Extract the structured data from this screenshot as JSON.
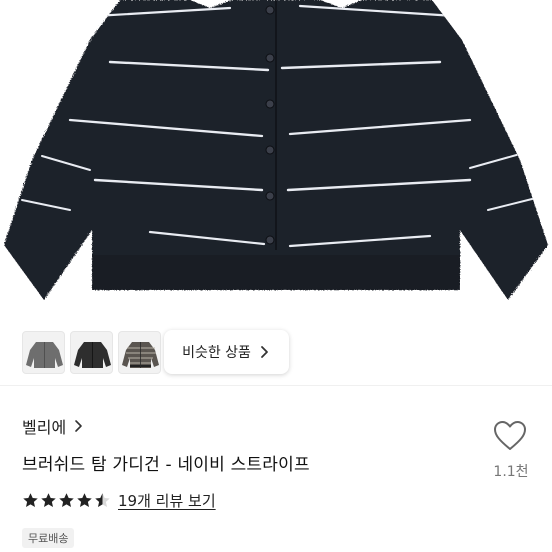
{
  "product": {
    "similar_button_label": "비슷한 상품",
    "brand": "벨리에",
    "title": "브러쉬드 탐 가디건 - 네이비 스트라이프",
    "likes": "1.1천",
    "rating": 4.5,
    "review_link": "19개 리뷰 보기",
    "shipping_badge": "무료배송"
  },
  "thumbnails": [
    {
      "name": "gray-cardigan",
      "color": "#6e6e6e"
    },
    {
      "name": "charcoal-cardigan",
      "color": "#2e2e2e"
    },
    {
      "name": "striped-cardigan",
      "color": "#5a5550"
    }
  ],
  "colors": {
    "garment_navy": "#1d2029",
    "stripe": "#e9ecf2",
    "heart_outline": "#666666",
    "star_fill": "#222222"
  }
}
